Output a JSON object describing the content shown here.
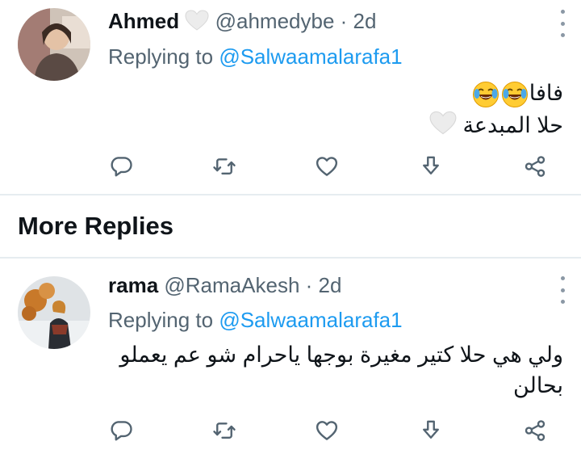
{
  "tweets": [
    {
      "name": "Ahmed",
      "handle": "@ahmedybe",
      "separator": "·",
      "time": "2d",
      "replying_prefix": "Replying to",
      "replying_to": "@Salwaamalarafa1",
      "lines": [
        "فافا",
        "حلا المبدعة"
      ]
    },
    {
      "name": "rama",
      "handle": "@RamaAkesh",
      "separator": "·",
      "time": "2d",
      "replying_prefix": "Replying to",
      "replying_to": "@Salwaamalarafa1",
      "lines": [
        "ولي هي حلا كتير مغيرة بوجها ياحرام شو عم يعملو",
        "بحالن"
      ]
    }
  ],
  "section": {
    "title": "More Replies"
  },
  "icons": {
    "reply": "reply-icon",
    "retweet": "retweet-icon",
    "like": "heart-icon",
    "share": "share-icon",
    "more": "more-vertical-icon",
    "tears": "face-with-tears-of-joy-emoji",
    "white_heart": "white-heart-emoji"
  },
  "colors": {
    "accent": "#1d9bf0",
    "secondary_text": "#536471",
    "icon": "#536471",
    "divider": "#e6ecf0"
  }
}
